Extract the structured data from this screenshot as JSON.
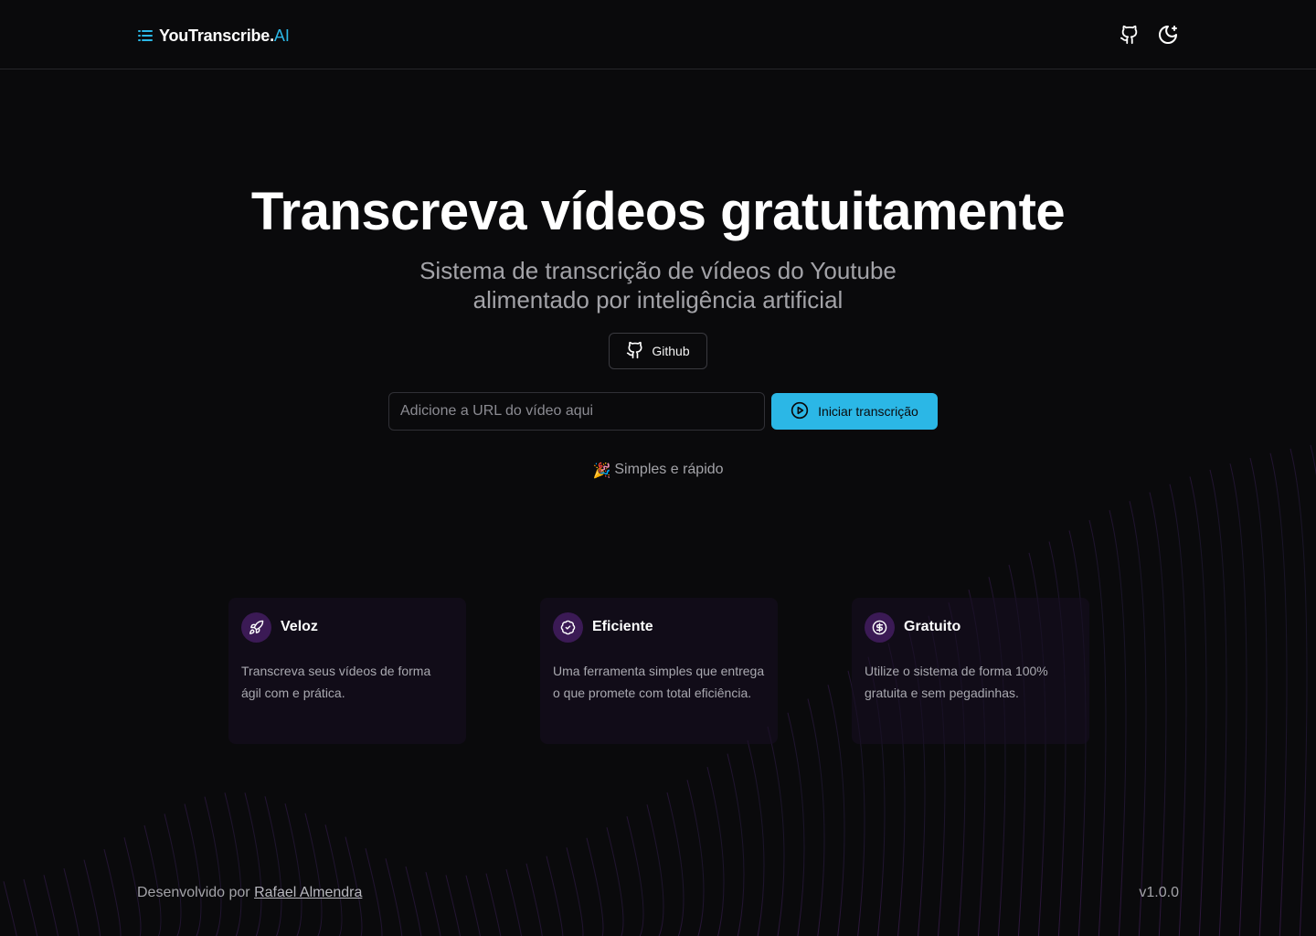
{
  "header": {
    "logo_text": "YouTranscribe.",
    "logo_accent": "AI",
    "github_icon": "github-icon",
    "theme_icon": "moon-icon"
  },
  "hero": {
    "title": "Transcreva vídeos gratuitamente",
    "subtitle": "Sistema de transcrição de vídeos do Youtube alimentado por inteligência artificial",
    "github_button": "Github"
  },
  "form": {
    "url_placeholder": "Adicione a URL do vídeo aqui",
    "url_value": "",
    "submit_label": "Iniciar transcrição"
  },
  "tagline": {
    "emoji": "🎉",
    "text": "Simples e rápido"
  },
  "features": [
    {
      "icon": "rocket-icon",
      "title": "Veloz",
      "description": "Transcreva seus vídeos de forma ágil com e prática."
    },
    {
      "icon": "badge-check-icon",
      "title": "Eficiente",
      "description": "Uma ferramenta simples que entrega o que promete com total eficiência."
    },
    {
      "icon": "dollar-circle-icon",
      "title": "Gratuito",
      "description": "Utilize o sistema de forma 100% gratuita e sem pegadinhas."
    }
  ],
  "footer": {
    "credit_prefix": "Desenvolvido por",
    "credit_name": "Rafael Almendra",
    "version": "v1.0.0"
  },
  "colors": {
    "background": "#0a0a0c",
    "accent": "#2bb7e6",
    "feature_icon_bg": "#3b1a55",
    "wave": "#7b2fa8"
  }
}
